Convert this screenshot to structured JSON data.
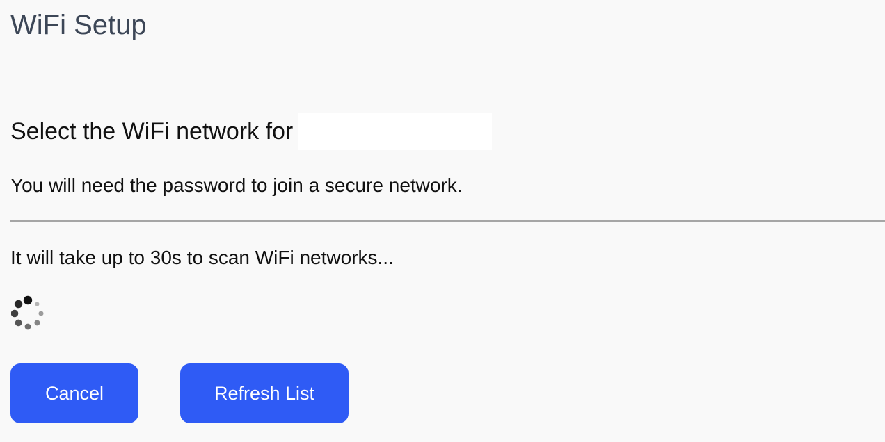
{
  "header": {
    "title": "WiFi Setup"
  },
  "main": {
    "select_heading": "Select the WiFi network for",
    "instruction": "You will need the password to join a secure network.",
    "scan_message": "It will take up to 30s to scan WiFi networks..."
  },
  "spinner": {
    "icon": "loading-spinner-icon",
    "dot_color": "#111111"
  },
  "buttons": {
    "cancel_label": "Cancel",
    "refresh_label": "Refresh List",
    "color": "#2f5bf5"
  }
}
